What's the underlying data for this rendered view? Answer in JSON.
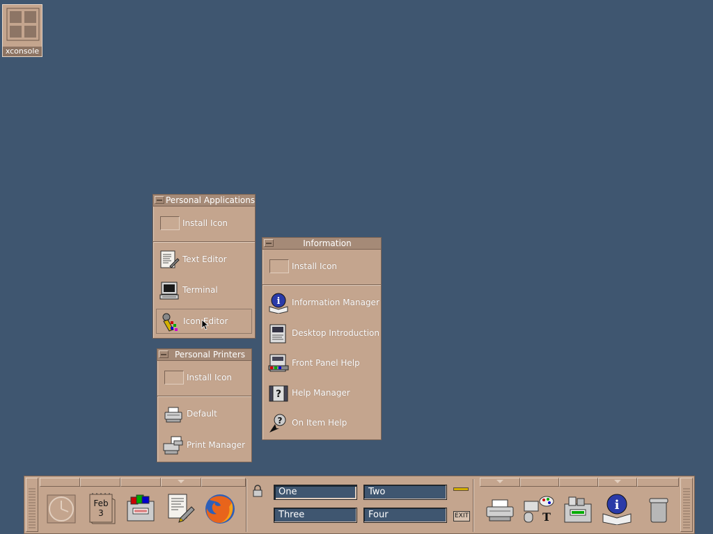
{
  "desktop": {
    "xconsole_label": "xconsole"
  },
  "personal_applications": {
    "title": "Personal Applications",
    "items": [
      {
        "label": "Install Icon",
        "icon": "install-drop-icon"
      },
      {
        "label": "Text Editor",
        "icon": "text-editor-icon"
      },
      {
        "label": "Terminal",
        "icon": "terminal-icon"
      },
      {
        "label": "Icon Editor",
        "icon": "icon-editor-icon"
      }
    ]
  },
  "personal_printers": {
    "title": "Personal Printers",
    "items": [
      {
        "label": "Install Icon",
        "icon": "install-drop-icon"
      },
      {
        "label": "Default",
        "icon": "printer-icon"
      },
      {
        "label": "Print Manager",
        "icon": "print-manager-icon"
      }
    ]
  },
  "information": {
    "title": "Information",
    "items": [
      {
        "label": "Install Icon",
        "icon": "install-drop-icon"
      },
      {
        "label": "Information Manager",
        "icon": "info-book-icon"
      },
      {
        "label": "Desktop Introduction",
        "icon": "desktop-intro-icon"
      },
      {
        "label": "Front Panel Help",
        "icon": "front-panel-help-icon"
      },
      {
        "label": "Help Manager",
        "icon": "help-manager-icon"
      },
      {
        "label": "On Item Help",
        "icon": "on-item-help-icon"
      }
    ]
  },
  "front_panel": {
    "calendar_month": "Feb",
    "calendar_day": "3",
    "workspaces": [
      "One",
      "Two",
      "Three",
      "Four"
    ],
    "active_workspace": "One",
    "exit_label": "EXIT",
    "icons": [
      "clock-icon",
      "calendar-icon",
      "file-manager-icon",
      "text-editor-icon",
      "firefox-icon",
      "lock-icon",
      "busy-light-icon",
      "exit-icon",
      "printer-icon",
      "style-manager-icon",
      "app-manager-icon",
      "info-book-icon",
      "trash-icon"
    ]
  },
  "colors": {
    "desktop_bg": "#3f5670",
    "panel_bg": "#c4a58e",
    "panel_dark": "#7a6354",
    "panel_light": "#e2cfbf"
  }
}
